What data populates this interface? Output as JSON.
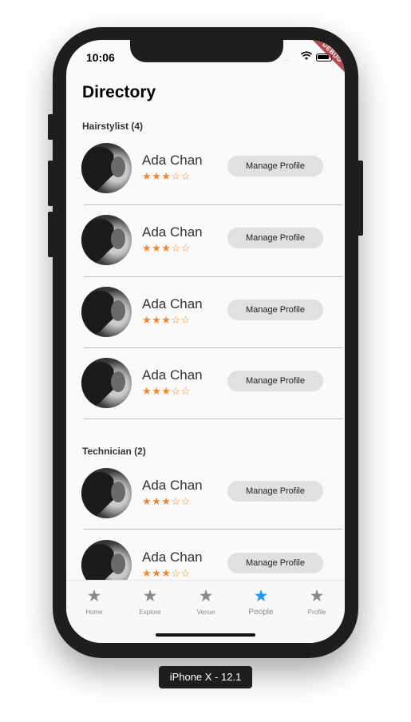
{
  "status_bar": {
    "time": "10:06",
    "signal": "....",
    "debug_banner": "DEBUG"
  },
  "page": {
    "title": "Directory"
  },
  "sections": [
    {
      "title": "Hairstylist (4)",
      "people": [
        {
          "name": "Ada Chan",
          "rating": 3,
          "max_rating": 5,
          "stars": "★★★☆☆",
          "button": "Manage Profile"
        },
        {
          "name": "Ada Chan",
          "rating": 3,
          "max_rating": 5,
          "stars": "★★★☆☆",
          "button": "Manage Profile"
        },
        {
          "name": "Ada Chan",
          "rating": 3,
          "max_rating": 5,
          "stars": "★★★☆☆",
          "button": "Manage Profile"
        },
        {
          "name": "Ada Chan",
          "rating": 3,
          "max_rating": 5,
          "stars": "★★★☆☆",
          "button": "Manage Profile"
        }
      ]
    },
    {
      "title": "Technician (2)",
      "people": [
        {
          "name": "Ada Chan",
          "rating": 3,
          "max_rating": 5,
          "stars": "★★★☆☆",
          "button": "Manage Profile"
        },
        {
          "name": "Ada Chan",
          "rating": 3,
          "max_rating": 5,
          "stars": "★★★☆☆",
          "button": "Manage Profile"
        }
      ]
    }
  ],
  "tabbar": {
    "items": [
      {
        "label": "Home",
        "icon": "star-icon",
        "active": false
      },
      {
        "label": "Explore",
        "icon": "star-icon",
        "active": false
      },
      {
        "label": "Venue",
        "icon": "star-icon",
        "active": false
      },
      {
        "label": "People",
        "icon": "star-icon",
        "active": true
      },
      {
        "label": "Profile",
        "icon": "star-icon",
        "active": false
      }
    ]
  },
  "device": {
    "label": "iPhone X - 12.1"
  },
  "colors": {
    "accent": "#2196f3",
    "star": "#f1862e",
    "debug": "#a62c34"
  }
}
